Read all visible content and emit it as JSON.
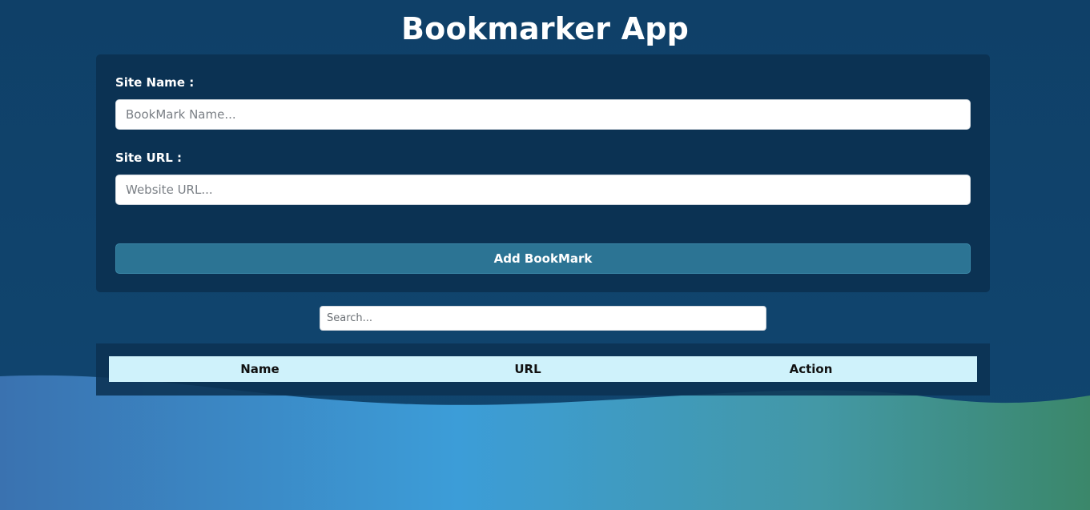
{
  "app": {
    "title": "Bookmarker App"
  },
  "form": {
    "site_name_label": "Site Name :",
    "site_name_placeholder": "BookMark Name...",
    "site_name_value": "",
    "site_url_label": "Site URL :",
    "site_url_placeholder": "Website URL...",
    "site_url_value": "",
    "add_button_label": "Add BookMark"
  },
  "search": {
    "placeholder": "Search...",
    "value": ""
  },
  "table": {
    "headers": [
      "Name",
      "URL",
      "Action"
    ],
    "rows": []
  },
  "colors": {
    "background": "#0f4068",
    "panel": "#0b3253",
    "button": "#2c7494",
    "table_header": "#cff2fb",
    "text_light": "#ffffff"
  }
}
